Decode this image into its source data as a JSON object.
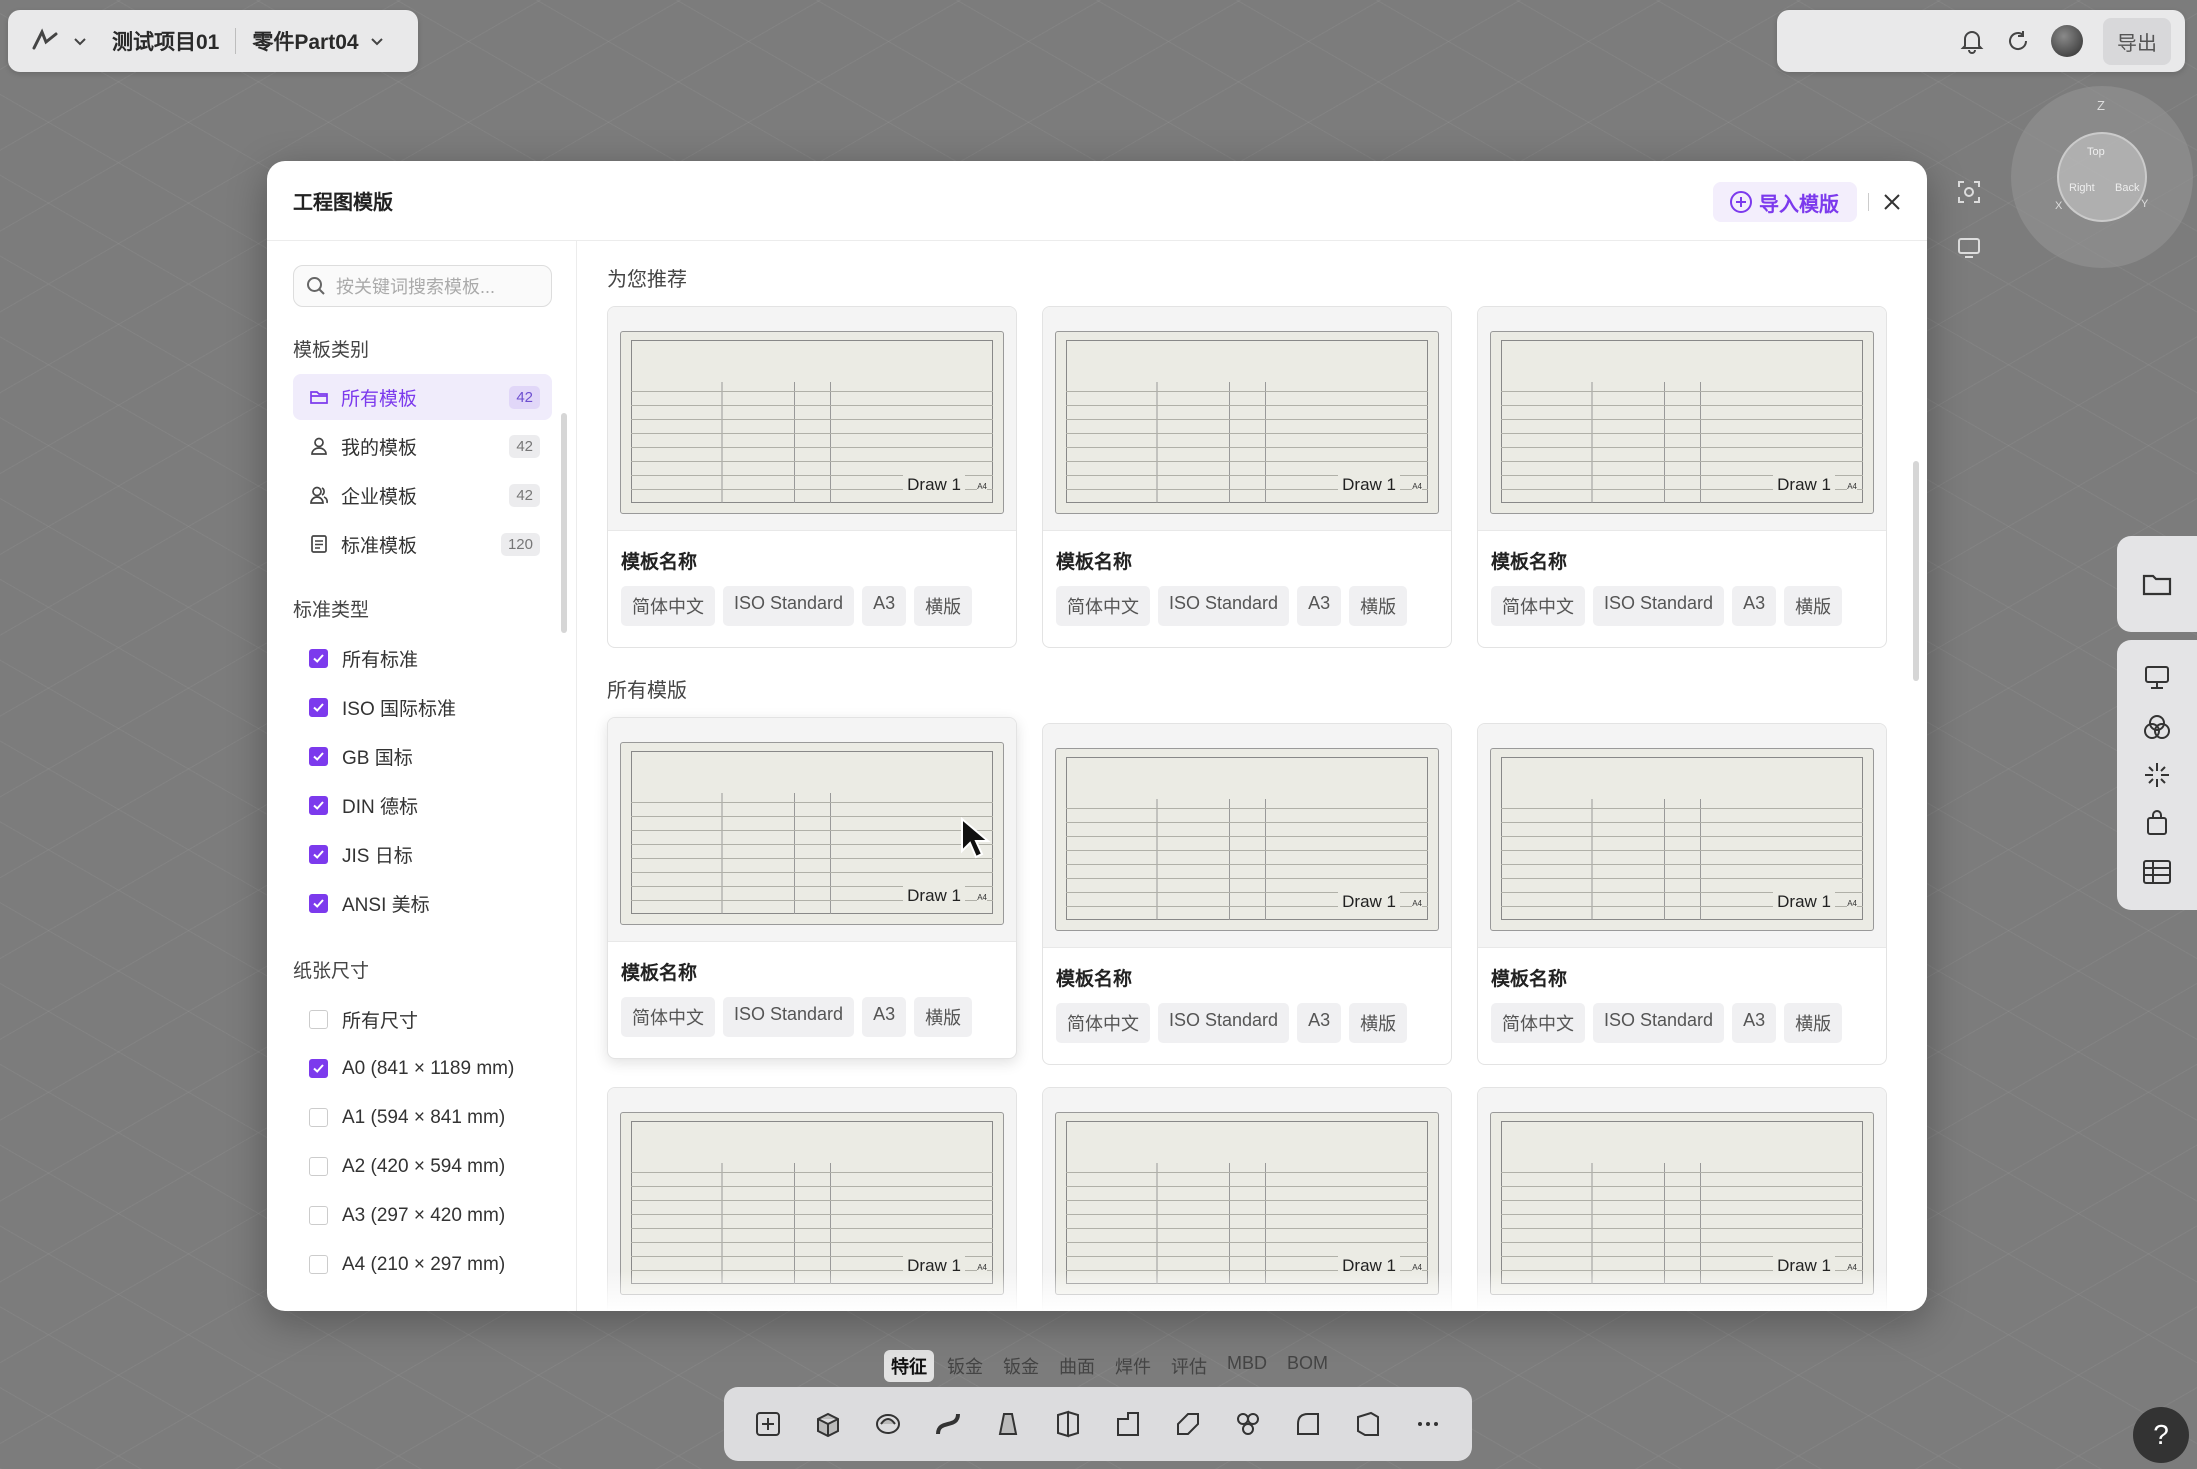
{
  "topbar": {
    "project": "测试项目01",
    "part": "零件Part04"
  },
  "topright": {
    "export": "导出"
  },
  "viewcube": {
    "faces": [
      "Z",
      "Top",
      "Right",
      "Back",
      "X",
      "Y"
    ]
  },
  "bottom": {
    "tabs": [
      "特征",
      "钣金",
      "钣金",
      "曲面",
      "焊件",
      "评估",
      "MBD",
      "BOM"
    ],
    "help": "?"
  },
  "modal": {
    "title": "工程图模版",
    "import_button": "导入模版",
    "search_placeholder": "按关键词搜索模板...",
    "category_heading": "模板类别",
    "categories": [
      {
        "label": "所有模板",
        "count": "42",
        "icon": "folder-icon"
      },
      {
        "label": "我的模板",
        "count": "42",
        "icon": "user-icon"
      },
      {
        "label": "企业模板",
        "count": "42",
        "icon": "users-icon"
      },
      {
        "label": "标准模板",
        "count": "120",
        "icon": "document-icon"
      }
    ],
    "standard_heading": "标准类型",
    "standards": [
      {
        "label": "所有标准",
        "checked": true
      },
      {
        "label": "ISO 国际标准",
        "checked": true
      },
      {
        "label": "GB 国标",
        "checked": true
      },
      {
        "label": "DIN 德标",
        "checked": true
      },
      {
        "label": "JIS 日标",
        "checked": true
      },
      {
        "label": "ANSI 美标",
        "checked": true
      }
    ],
    "paper_heading": "纸张尺寸",
    "papers": [
      {
        "label": "所有尺寸",
        "checked": false
      },
      {
        "label": "A0 (841 × 1189 mm)",
        "checked": true
      },
      {
        "label": "A1 (594 × 841 mm)",
        "checked": false
      },
      {
        "label": "A2 (420 × 594 mm)",
        "checked": false
      },
      {
        "label": "A3 (297 × 420 mm)",
        "checked": false
      },
      {
        "label": "A4 (210 × 297 mm)",
        "checked": false
      }
    ],
    "recommended_heading": "为您推荐",
    "all_heading": "所有模版",
    "card": {
      "name": "模板名称",
      "tags": [
        "简体中文",
        "ISO Standard",
        "A3",
        "横版"
      ],
      "drawing_label": "Draw 1",
      "sheet_size": "A4"
    },
    "accent_color": "#7c3aed"
  }
}
